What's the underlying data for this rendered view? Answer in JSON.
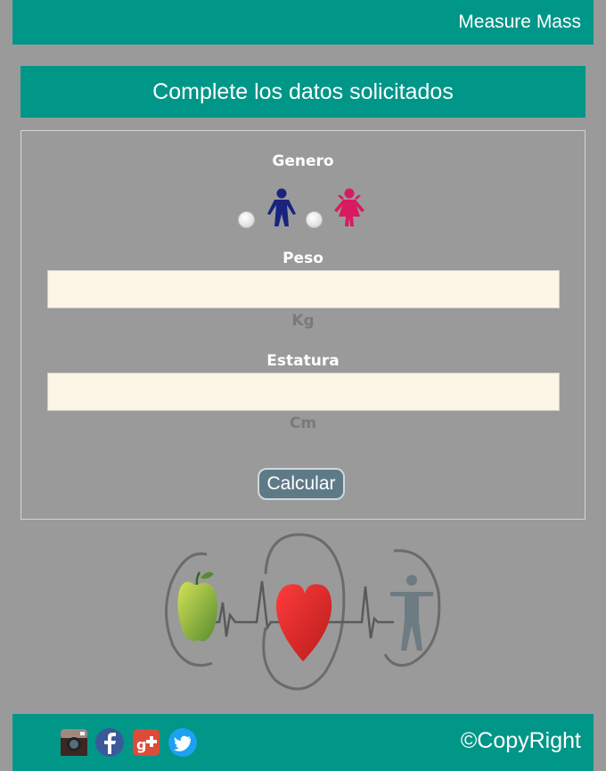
{
  "header": {
    "brand": "Measure Mass"
  },
  "form": {
    "title": "Complete los datos solicitados",
    "gender_label": "Genero",
    "gender_options": [
      "male",
      "female"
    ],
    "weight_label": "Peso",
    "weight_value": "",
    "weight_unit": "Kg",
    "height_label": "Estatura",
    "height_value": "",
    "height_unit": "Cm",
    "submit_label": "Calcular"
  },
  "logo": {
    "icons": [
      "apple-icon",
      "heartbeat-icon",
      "heart-icon",
      "human-figure-icon"
    ]
  },
  "footer": {
    "social": [
      "instagram-icon",
      "facebook-icon",
      "google-plus-icon",
      "twitter-icon"
    ],
    "copyright": "©CopyRight"
  },
  "colors": {
    "background": "#9a9a9a",
    "accent": "#009688",
    "input_bg": "#fdf5e6",
    "button": "#5e7a87",
    "male": "#1a237e",
    "female": "#d81b60"
  }
}
